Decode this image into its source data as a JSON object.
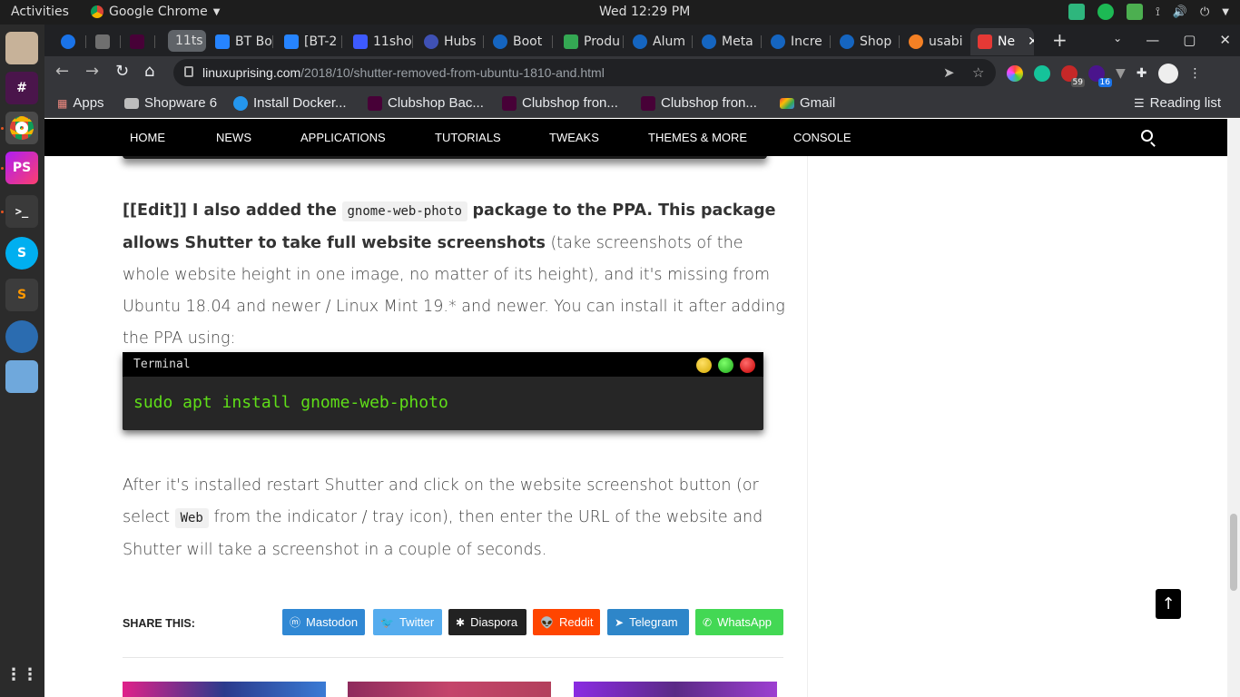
{
  "topbar": {
    "activities": "Activities",
    "app_name": "Google Chrome",
    "clock": "Wed 12:29 PM"
  },
  "tabs": [
    {
      "label": "",
      "color": "#1a73e8"
    },
    {
      "label": "",
      "color": "#6f6f6f"
    },
    {
      "label": "",
      "color": "#470137"
    },
    {
      "label": "11ts",
      "color": ""
    },
    {
      "label": "BT Bo",
      "color": "#2684ff"
    },
    {
      "label": "[BT-2",
      "color": "#2684ff"
    },
    {
      "label": "11sho",
      "color": "#3d5afe"
    },
    {
      "label": "Hubs",
      "color": "#3f51b5"
    },
    {
      "label": "Boot",
      "color": "#1565c0"
    },
    {
      "label": "Produ",
      "color": "#34a853"
    },
    {
      "label": "Alum",
      "color": "#1565c0"
    },
    {
      "label": "Meta",
      "color": "#1565c0"
    },
    {
      "label": "Incre",
      "color": "#1565c0"
    },
    {
      "label": "Shop",
      "color": "#1565c0"
    },
    {
      "label": "usabi",
      "color": "#f48024"
    },
    {
      "label": "Ne",
      "color": "#e53935"
    }
  ],
  "address": {
    "domain": "linuxuprising.com",
    "path": "/2018/10/shutter-removed-from-ubuntu-1810-and.html"
  },
  "extensions": {
    "badge_1": "59",
    "badge_2": "16"
  },
  "bookmarks": [
    {
      "label": "Apps"
    },
    {
      "label": "Shopware 6"
    },
    {
      "label": "Install Docker..."
    },
    {
      "label": "Clubshop Bac..."
    },
    {
      "label": "Clubshop fron..."
    },
    {
      "label": "Clubshop fron..."
    },
    {
      "label": "Gmail"
    }
  ],
  "reading_list": "Reading list",
  "site_nav": [
    "HOME",
    "NEWS",
    "APPLICATIONS",
    "TUTORIALS",
    "TWEAKS",
    "THEMES & MORE",
    "CONSOLE"
  ],
  "article": {
    "p1_bold_start": "[[Edit]] I also added the",
    "p1_code": "gnome-web-photo",
    "p1_bold_end": "package to the PPA. This package allows Shutter to take full website screenshots",
    "p1_rest": "(take screenshots of the whole website height in one image, no matter of its height), and it's missing from Ubuntu 18.04 and newer / Linux Mint 19.* and newer. You can install it after adding the PPA using:",
    "terminal_title": "Terminal",
    "terminal_cmd": "sudo apt install gnome-web-photo",
    "p2_start": "After it's installed restart Shutter and click on the website screenshot button (or select",
    "p2_code": "Web",
    "p2_end": "from the indicator / tray icon), then enter the URL of the website and Shutter will take a screenshot in a couple of seconds."
  },
  "share": {
    "label": "SHARE THIS:",
    "buttons": [
      {
        "label": "Mastodon",
        "color": "#3088d4"
      },
      {
        "label": "Twitter",
        "color": "#55acee"
      },
      {
        "label": "Diaspora",
        "color": "#222222"
      },
      {
        "label": "Reddit",
        "color": "#ff4500"
      },
      {
        "label": "Telegram",
        "color": "#2e86c9"
      },
      {
        "label": "WhatsApp",
        "color": "#43d854"
      }
    ]
  }
}
